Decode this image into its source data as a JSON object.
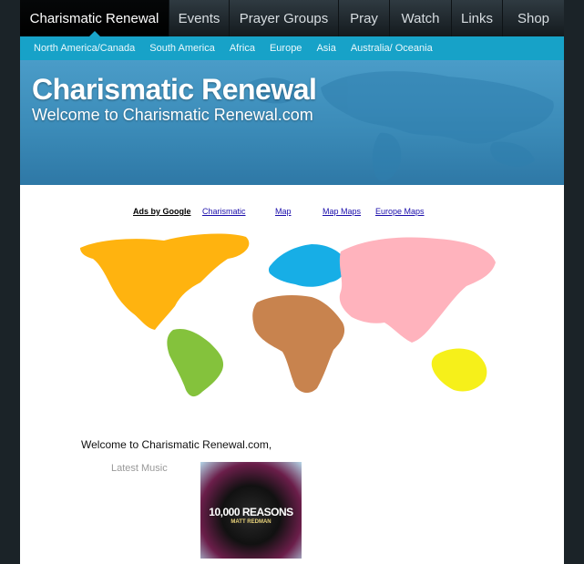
{
  "nav": {
    "items": [
      {
        "label": "Charismatic Renewal",
        "active": true
      },
      {
        "label": "Events"
      },
      {
        "label": "Prayer Groups"
      },
      {
        "label": "Pray"
      },
      {
        "label": "Watch"
      },
      {
        "label": "Links"
      },
      {
        "label": "Shop"
      }
    ]
  },
  "subnav": {
    "items": [
      "North America/Canada",
      "South America",
      "Africa",
      "Europe",
      "Asia",
      "Australia/ Oceania"
    ]
  },
  "banner": {
    "title": "Charismatic Renewal",
    "subtitle": "Welcome to Charismatic Renewal.com"
  },
  "ads": {
    "label": "Ads by Google",
    "links": [
      "Charismatic",
      "Map",
      "Map Maps",
      "Europe Maps"
    ]
  },
  "map": {
    "regions": [
      {
        "name": "north-america",
        "color": "#ffb30f"
      },
      {
        "name": "south-america",
        "color": "#84c23c"
      },
      {
        "name": "europe",
        "color": "#17aee6"
      },
      {
        "name": "africa",
        "color": "#c8834e"
      },
      {
        "name": "asia",
        "color": "#ffb3bd"
      },
      {
        "name": "oceania",
        "color": "#f6f01a"
      }
    ]
  },
  "content": {
    "welcome": "Welcome to Charismatic Renewal.com,",
    "latest_music": "Latest Music",
    "album_title": "10,000 REASONS",
    "album_artist": "MATT REDMAN"
  },
  "colors": {
    "nav_bg": "#1f282d",
    "subnav_bg": "#17a2c8",
    "banner_bg": "#3b8bb8",
    "page_bg": "#1b2328"
  }
}
